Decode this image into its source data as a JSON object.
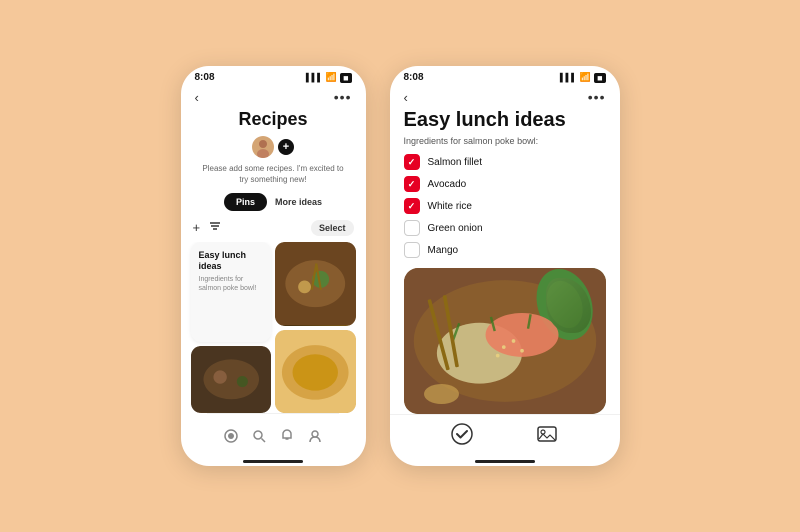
{
  "left_phone": {
    "status": {
      "time": "8:08",
      "signal": "▌▌▌",
      "wifi": "WiFi",
      "battery": "🔋"
    },
    "nav": {
      "back_label": "‹",
      "more_label": "•••"
    },
    "title": "Recipes",
    "subtitle": "Please add some recipes. I'm excited to try something new!",
    "tabs": {
      "active": "Pins",
      "inactive": "More ideas"
    },
    "toolbar": {
      "add_label": "+",
      "filter_label": "⚙",
      "select_label": "Select"
    },
    "card": {
      "title": "Easy lunch ideas",
      "subtitle": "Ingredients for salmon poke bowl!"
    },
    "bottom_nav": {
      "home": "⊙",
      "search": "🔍",
      "bell": "🔔",
      "profile": "👤"
    }
  },
  "right_phone": {
    "status": {
      "time": "8:08",
      "signal": "▌▌▌",
      "wifi": "WiFi",
      "battery": "🔋"
    },
    "nav": {
      "back_label": "‹",
      "more_label": "•••"
    },
    "title": "Easy lunch ideas",
    "ingredients_label": "Ingredients for salmon poke bowl:",
    "checklist": [
      {
        "id": "salmon",
        "label": "Salmon fillet",
        "checked": true
      },
      {
        "id": "avocado",
        "label": "Avocado",
        "checked": true
      },
      {
        "id": "white_rice",
        "label": "White rice",
        "checked": true
      },
      {
        "id": "green_onion",
        "label": "Green onion",
        "checked": false
      },
      {
        "id": "mango",
        "label": "Mango",
        "checked": false
      }
    ],
    "bottom_actions": {
      "check_label": "✓",
      "image_label": "🖼"
    }
  }
}
